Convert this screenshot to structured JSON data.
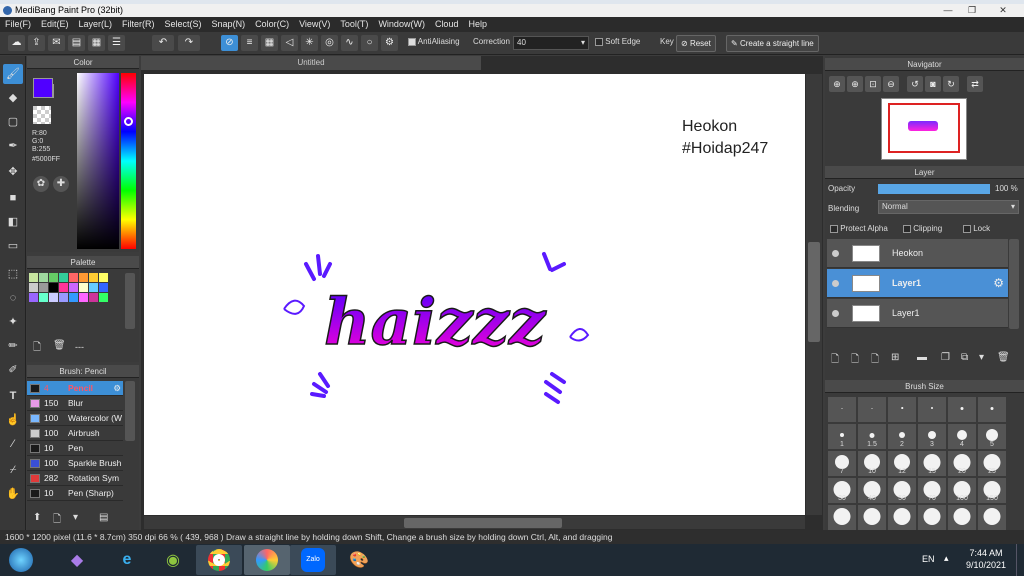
{
  "window": {
    "title": "MediBang Paint Pro (32bit)",
    "minimize": "—",
    "maximize": "❐",
    "close": "✕"
  },
  "menu": [
    "File(F)",
    "Edit(E)",
    "Layer(L)",
    "Filter(R)",
    "Select(S)",
    "Snap(N)",
    "Color(C)",
    "View(V)",
    "Tool(T)",
    "Window(W)",
    "Cloud",
    "Help"
  ],
  "toolbar": {
    "antialiasing_label": "AntiAliasing",
    "correction_label": "Correction",
    "correction_value": "40",
    "soft_edge_label": "Soft Edge",
    "key_label": "Key",
    "reset_label": "Reset",
    "straight_line_label": "Create a straight line"
  },
  "color_panel": {
    "title": "Color",
    "r": "R:80",
    "g": "G:0",
    "b": "B:255",
    "hex": "#5000FF",
    "main_color": "#5000FF"
  },
  "palette": {
    "title": "Palette",
    "footer": "---",
    "colors": [
      "#c8e6a0",
      "#9fd99f",
      "#66cc66",
      "#33cc99",
      "#ff6666",
      "#ff9933",
      "#ffcc33",
      "#ffff66",
      "#cccccc",
      "#999999",
      "#000000",
      "#ff3399",
      "#cc66ff",
      "#ffffcc",
      "#66ccff",
      "#3366ff",
      "#9966ff",
      "#66ffcc",
      "#ccccff",
      "#9999ff",
      "#3399ff",
      "#ff66ff",
      "#cc3399",
      "#33ff66"
    ]
  },
  "brush": {
    "title": "Brush: Pencil",
    "items": [
      {
        "size": "4",
        "name": "Pencil",
        "color": "#1a1a1a"
      },
      {
        "size": "150",
        "name": "Blur",
        "color": "#e89ae8"
      },
      {
        "size": "100",
        "name": "Watercolor (W",
        "color": "#7ab8ff"
      },
      {
        "size": "100",
        "name": "Airbrush",
        "color": "#cccccc"
      },
      {
        "size": "10",
        "name": "Pen",
        "color": "#1a1a1a"
      },
      {
        "size": "100",
        "name": "Sparkle Brush",
        "color": "#3a4fd6"
      },
      {
        "size": "282",
        "name": "Rotation Sym",
        "color": "#e03a3a"
      },
      {
        "size": "10",
        "name": "Pen (Sharp)",
        "color": "#1a1a1a"
      }
    ]
  },
  "document": {
    "tab": "Untitled",
    "watermark_line1": "Heokon",
    "watermark_line2": "#Hoidap247",
    "drawing_text": "haizzz"
  },
  "navigator": {
    "title": "Navigator"
  },
  "layer_panel": {
    "title": "Layer",
    "opacity_label": "Opacity",
    "opacity_value": "100 %",
    "opacity": 1.0,
    "blending_label": "Blending",
    "blending_value": "Normal",
    "protect_alpha": "Protect Alpha",
    "clipping": "Clipping",
    "lock": "Lock",
    "layers": [
      {
        "name": "Heokon",
        "selected": false
      },
      {
        "name": "Layer1",
        "selected": true
      },
      {
        "name": "Layer1",
        "selected": false
      }
    ]
  },
  "brush_size": {
    "title": "Brush Size",
    "sizes": [
      "",
      "",
      "",
      "",
      "",
      "",
      "1",
      "1.5",
      "2",
      "3",
      "4",
      "5",
      "7",
      "10",
      "12",
      "15",
      "20",
      "25",
      "30",
      "40",
      "50",
      "70",
      "100",
      "150",
      "",
      "",
      "",
      "",
      "",
      ""
    ]
  },
  "status": {
    "text": "1600 * 1200 pixel  (11.6 * 8.7cm)  350 dpi  66 %  ( 439, 968 )  Draw a straight line by holding down Shift, Change a brush size by holding down Ctrl, Alt, and dragging"
  },
  "taskbar": {
    "language": "EN",
    "time": "7:44 AM",
    "date": "9/10/2021",
    "zalo_label": "Zalo"
  }
}
